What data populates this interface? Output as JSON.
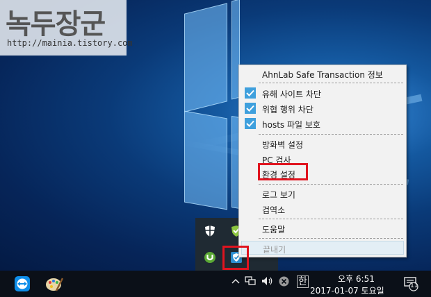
{
  "watermark": {
    "title": "녹두장군",
    "url": "http://mainia.tistory.com"
  },
  "context_menu": {
    "header": "AhnLab Safe Transaction 정보",
    "items": [
      {
        "label": "유해 사이트 차단",
        "checked": true
      },
      {
        "label": "위협 행위 차단",
        "checked": true
      },
      {
        "label": "hosts 파일 보호",
        "checked": true
      },
      {
        "label": "방화벽 설정"
      },
      {
        "label": "PC 검사"
      },
      {
        "label": "환경 설정",
        "highlighted": true
      },
      {
        "label": "로그 보기"
      },
      {
        "label": "검역소"
      },
      {
        "label": "도움말"
      },
      {
        "label": "끝내기",
        "disabled": true
      }
    ]
  },
  "tray": {
    "icons": [
      "defender-icon",
      "green-shield-icon",
      "utorrent-icon",
      "ahnlab-safe-transaction-icon"
    ]
  },
  "taskbar": {
    "apps": [
      "teamviewer-icon",
      "paint-icon"
    ],
    "ime": "한",
    "clock_time": "오후 6:51",
    "clock_date": "2017-01-07 토요일",
    "notification_count": "11"
  },
  "colors": {
    "highlight": "#e0141f",
    "check": "#3fa0dd",
    "menu_bg": "#f2f2f2"
  }
}
